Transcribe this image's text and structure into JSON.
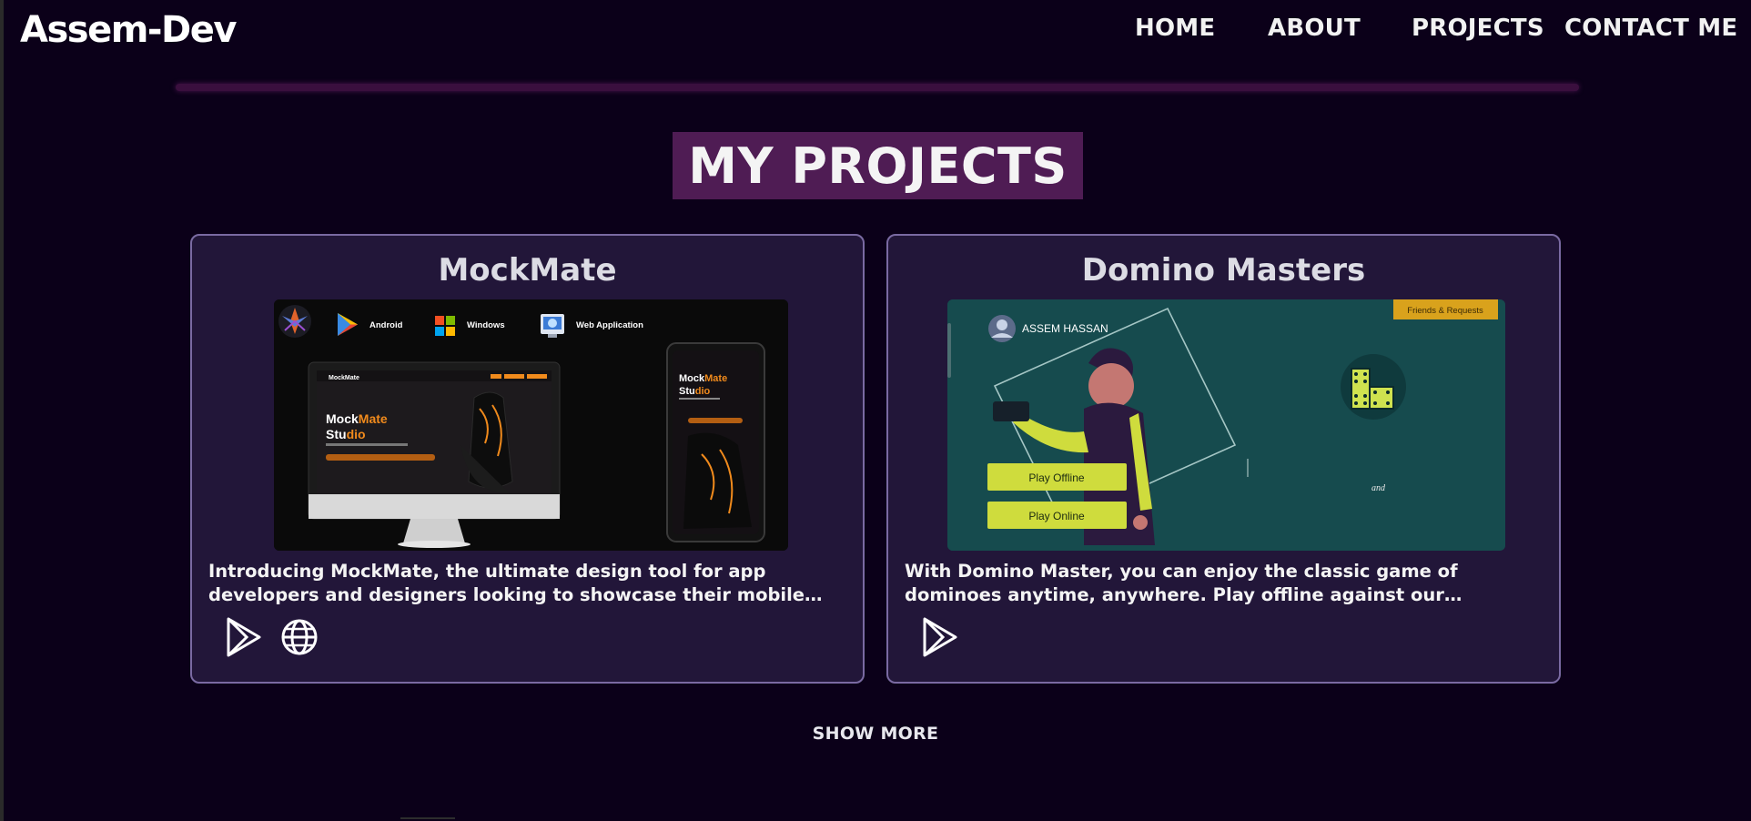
{
  "site": {
    "logo": "Assem-Dev"
  },
  "nav": {
    "items": [
      "HOME",
      "ABOUT",
      "PROJECTS",
      "CONTACT ME"
    ]
  },
  "section": {
    "title": "MY PROJECTS"
  },
  "projects": [
    {
      "title": "MockMate",
      "description": "Introducing MockMate, the ultimate design tool for app developers and designers looking to showcase their mobile applications. With MockMate, you can create stunning mockups in seconds.",
      "links": [
        "google-play-icon",
        "globe-icon"
      ],
      "screenshot": {
        "platforms": [
          "Android",
          "Windows",
          "Web Application"
        ],
        "brand_line1_a": "Mock",
        "brand_line1_b": "Mate",
        "brand_line2_a": "Stu",
        "brand_line2_b": "dio",
        "header_brand": "MockMate"
      }
    },
    {
      "title": "Domino Masters",
      "description": "With Domino Master, you can enjoy the classic game of dominoes anytime, anywhere. Play offline against our intelligent bot opponent, or play online with friends.",
      "links": [
        "google-play-icon"
      ],
      "screenshot": {
        "player": "ASSEM HASSAN",
        "friends_tab": "Friends & Requests",
        "buttons": [
          "Play Offline",
          "Play Online"
        ],
        "caption": "and"
      }
    }
  ],
  "footer": {
    "show_more": "SHOW MORE"
  },
  "colors": {
    "background": "#0b0019",
    "card": "#221639",
    "card_border": "#7a6aa2",
    "title_bg": "#4f1c54",
    "accent_orange": "#f08a1c",
    "accent_lime": "#c8e041",
    "teal": "#164b4e"
  }
}
